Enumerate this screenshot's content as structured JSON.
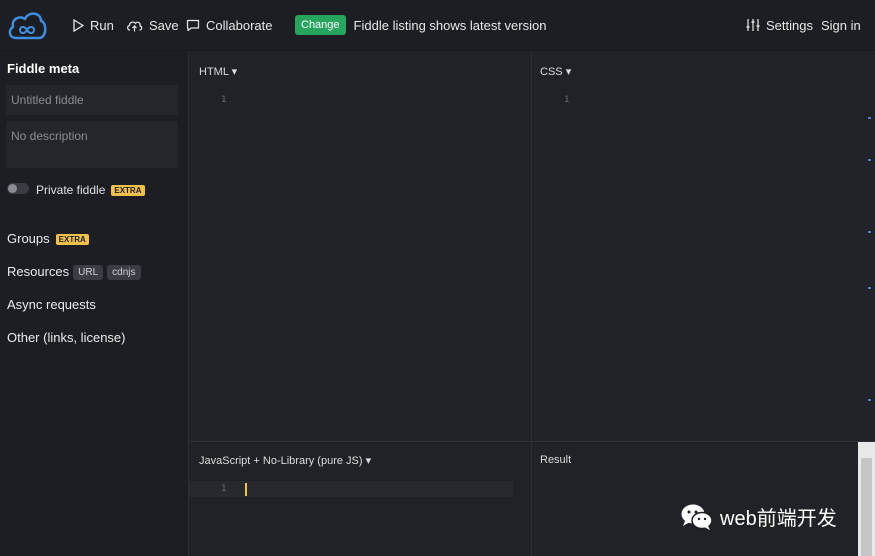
{
  "header": {
    "run_label": "Run",
    "save_label": "Save",
    "collaborate_label": "Collaborate",
    "change_badge": "Change",
    "notice": "Fiddle listing shows latest version",
    "settings_label": "Settings",
    "signin_label": "Sign in"
  },
  "sidebar": {
    "title": "Fiddle meta",
    "title_placeholder": "Untitled fiddle",
    "description_placeholder": "No description",
    "private_label": "Private fiddle",
    "extra_badge": "EXTRA",
    "groups_label": "Groups",
    "resources_label": "Resources",
    "resources_chips": [
      "URL",
      "cdnjs"
    ],
    "async_label": "Async requests",
    "other_label": "Other (links, license)"
  },
  "panels": {
    "html_title": "HTML",
    "css_title": "CSS",
    "js_title": "JavaScript + No-Library (pure JS)",
    "result_title": "Result",
    "line_number": "1"
  },
  "watermark": {
    "text": "web前端开发"
  },
  "colors": {
    "accent_green": "#27a55f",
    "extra_yellow": "#f0c04a",
    "logo_blue": "#3f8de0"
  }
}
